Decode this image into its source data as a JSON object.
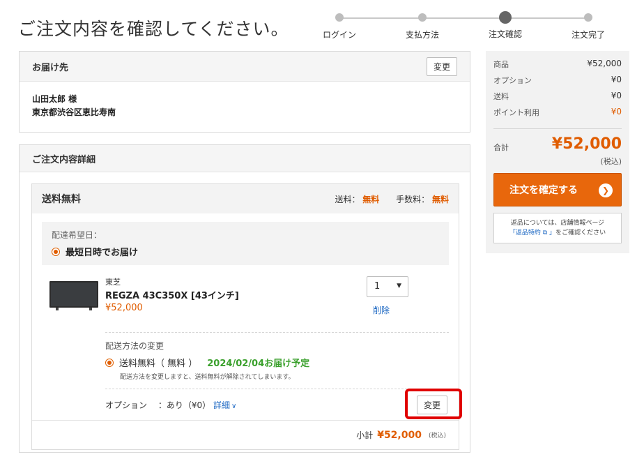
{
  "page": {
    "title": "ご注文内容を確認してください。"
  },
  "stepper": {
    "steps": [
      {
        "label": "ログイン"
      },
      {
        "label": "支払方法"
      },
      {
        "label": "注文確認"
      },
      {
        "label": "注文完了"
      }
    ],
    "active_step": "注文確認"
  },
  "shipping_address": {
    "header": "お届け先",
    "change_label": "変更",
    "name": "山田太郎 様",
    "address": "東京都渋谷区恵比寿南"
  },
  "order_details": {
    "header": "ご注文内容詳細",
    "shipment": {
      "title": "送料無料",
      "shipping_fee_label": "送料：",
      "shipping_fee_value": "無料",
      "handling_fee_label": "手数料：",
      "handling_fee_value": "無料",
      "delivery_date_label": "配達希望日：",
      "delivery_date_value": "最短日時でお届け",
      "product": {
        "brand": "東芝",
        "name": "REGZA 43C350X [43インチ]",
        "price": "¥52,000",
        "quantity": "1",
        "delete_label": "削除"
      },
      "shipping_method": {
        "title": "配送方法の変更",
        "option": "送料無料（ 無料 ）",
        "delivery_estimate": "2024/02/04お届け予定",
        "note": "配送方法を変更しますと、送料無料が解除されてしまいます。"
      },
      "options": {
        "label": "オプション",
        "value": "：あり（¥0）",
        "detail_label": "詳細",
        "change_label": "変更"
      },
      "subtotal": {
        "label": "小計",
        "amount": "¥52,000",
        "tax": "(税込)"
      }
    }
  },
  "summary": {
    "rows": [
      {
        "label": "商品",
        "value": "¥52,000"
      },
      {
        "label": "オプション",
        "value": "¥0"
      },
      {
        "label": "送料",
        "value": "¥0"
      },
      {
        "label": "ポイント利用",
        "value": "¥0"
      }
    ],
    "total_label": "合計",
    "total_value": "¥52,000",
    "tax_note": "(税込)",
    "confirm_label": "注文を確定する",
    "returns_text_1": "返品については、店舗情報ページ",
    "returns_link": "「返品特約 ⧉ 」",
    "returns_text_2": "をご確認ください"
  },
  "colors": {
    "accent": "#e8670c",
    "price": "#e05c00",
    "link": "#1a66c2",
    "success": "#3aa02c",
    "highlight": "#e00000"
  }
}
